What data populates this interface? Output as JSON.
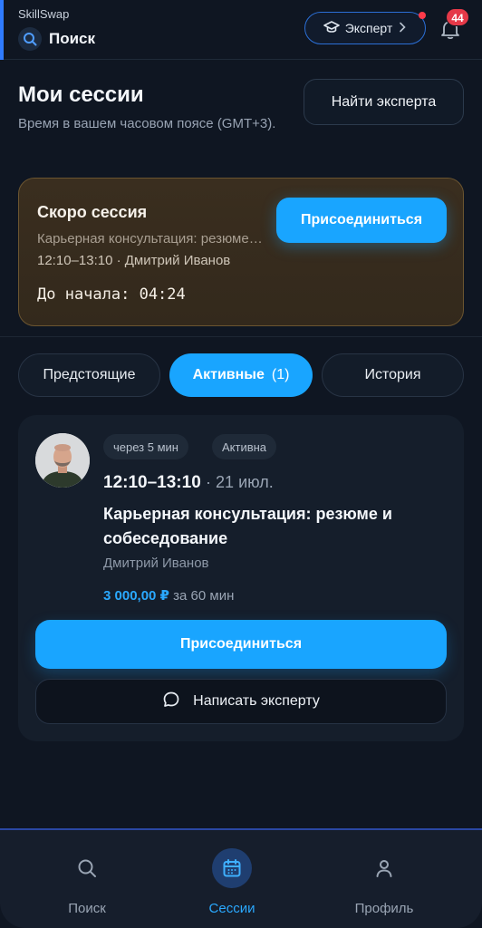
{
  "header": {
    "brand": "SkillSwap",
    "search_label": "Поиск",
    "expert_button_label": "Эксперт",
    "notification_count": "44"
  },
  "page": {
    "title": "Мои сессии",
    "timezone_note": "Время в вашем часовом поясе (GMT+3).",
    "find_expert_label": "Найти эксперта"
  },
  "upcoming_banner": {
    "title": "Скоро сессия",
    "subtitle": "Карьерная консультация: резюме и собеседование",
    "time_and_expert": "12:10–13:10 · Дмитрий Иванов",
    "countdown": "До начала: 04:24",
    "join_label": "Присоединиться"
  },
  "tabs": [
    {
      "label": "Предстоящие",
      "count": ""
    },
    {
      "label": "Активные",
      "count": "(1)"
    },
    {
      "label": "История",
      "count": ""
    }
  ],
  "session": {
    "chips": [
      "через 5 мин",
      "Активна"
    ],
    "time": "12:10–13:10",
    "date": "· 21 июл.",
    "title": "Карьерная консультация: резюме и собеседование",
    "expert": "Дмитрий Иванов",
    "price": "3 000,00 ₽",
    "duration": "за 60 мин",
    "join_label": "Присоединиться",
    "message_label": "Написать эксперту"
  },
  "bottom_nav": [
    {
      "label": "Поиск",
      "icon": "search-icon"
    },
    {
      "label": "Сессии",
      "icon": "calendar-icon"
    },
    {
      "label": "Профиль",
      "icon": "user-icon"
    }
  ],
  "colors": {
    "accent": "#19a5ff",
    "background": "#0f1622",
    "banner": "#3a2e1f",
    "badge": "#e53948"
  }
}
